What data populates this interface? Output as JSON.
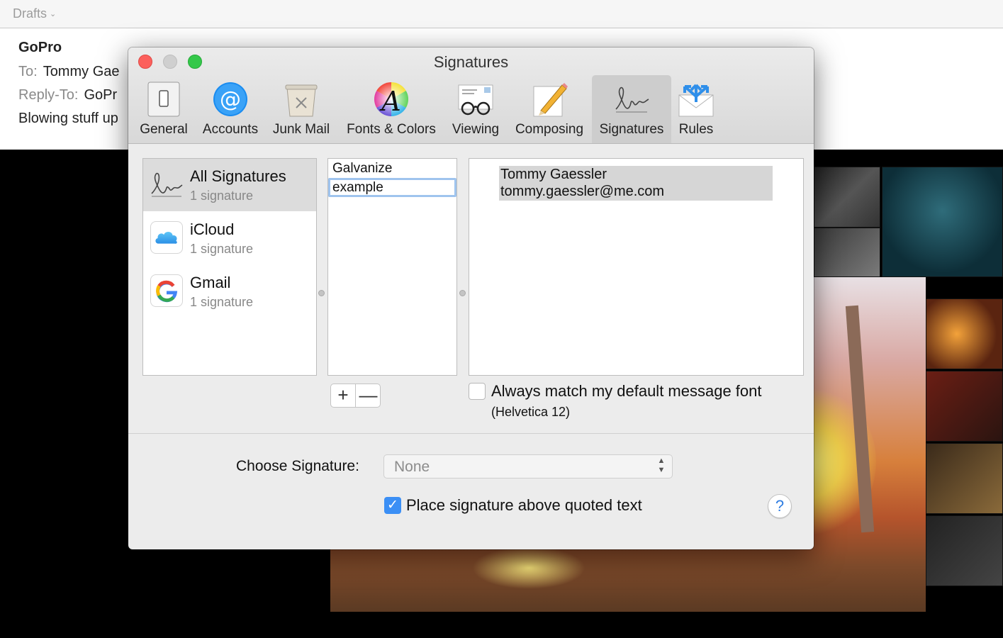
{
  "mail": {
    "mailbox": "Drafts",
    "from": "GoPro",
    "to_label": "To:",
    "to_value": "Tommy Gae",
    "reply_to_label": "Reply-To:",
    "reply_to_value": "GoPr",
    "subject": "Blowing stuff up"
  },
  "prefs": {
    "title": "Signatures",
    "toolbar": {
      "general": "General",
      "accounts": "Accounts",
      "junk": "Junk Mail",
      "fonts": "Fonts & Colors",
      "viewing": "Viewing",
      "composing": "Composing",
      "signatures": "Signatures",
      "rules": "Rules",
      "selected": "signatures"
    },
    "accounts": [
      {
        "name": "All Signatures",
        "count": "1 signature",
        "icon": "signature-icon"
      },
      {
        "name": "iCloud",
        "count": "1 signature",
        "icon": "icloud-icon"
      },
      {
        "name": "Gmail",
        "count": "1 signature",
        "icon": "google-icon"
      }
    ],
    "signatures": [
      "Galvanize",
      "example"
    ],
    "signature_content": {
      "name": "Tommy Gaessler",
      "email": "tommy.gaessler@me.com"
    },
    "add_label": "+",
    "remove_label": "—",
    "match_font_label": "Always match my default message font",
    "match_font_detail": "(Helvetica 12)",
    "choose_label": "Choose Signature:",
    "choose_value": "None",
    "place_label": "Place signature above quoted text",
    "help_label": "?",
    "colors": {
      "accent": "#3b8ff5",
      "close": "#fc605c",
      "zoom": "#34c84a"
    }
  }
}
